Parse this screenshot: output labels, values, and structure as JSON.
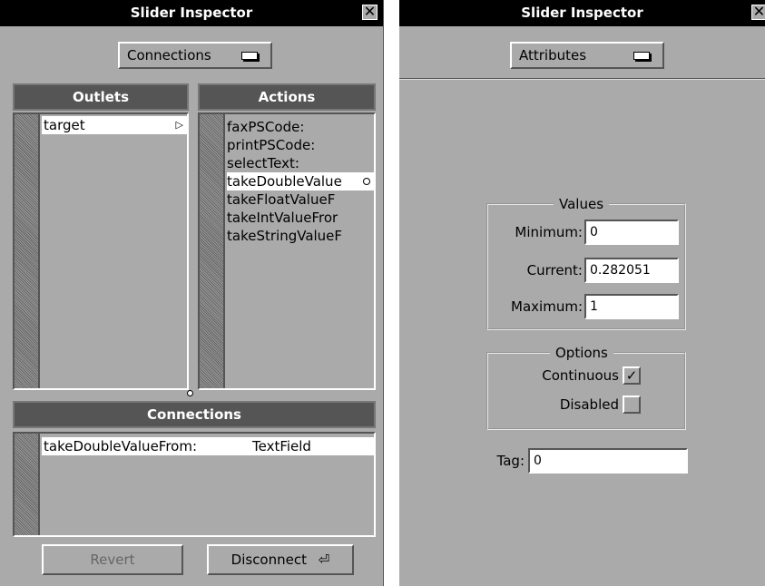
{
  "connections_inspector": {
    "title": "Slider Inspector",
    "mode_popup": "Connections",
    "outlets_header": "Outlets",
    "actions_header": "Actions",
    "outlets": [
      "target"
    ],
    "actions": [
      "faxPSCode:",
      "printPSCode:",
      "selectText:",
      "takeDoubleValue",
      "takeFloatValueF",
      "takeIntValueFror",
      "takeStringValueF"
    ],
    "selected_action": "takeDoubleValue",
    "connections_header": "Connections",
    "connections": [
      {
        "action": "takeDoubleValueFrom:",
        "target": "TextField"
      }
    ],
    "revert_label": "Revert",
    "disconnect_label": "Disconnect",
    "return_glyph": "⏎"
  },
  "attributes_inspector": {
    "title": "Slider Inspector",
    "mode_popup": "Attributes",
    "values_group": "Values",
    "minimum_label": "Minimum:",
    "minimum_value": "0",
    "current_label": "Current:",
    "current_value": "0.282051",
    "maximum_label": "Maximum:",
    "maximum_value": "1",
    "options_group": "Options",
    "continuous_label": "Continuous",
    "continuous_checked": true,
    "disabled_label": "Disabled",
    "disabled_checked": false,
    "tag_label": "Tag:",
    "tag_value": "0"
  },
  "icons": {
    "close": "close-icon",
    "popup": "popup-icon",
    "arrow": "outlet-arrow-icon"
  },
  "colors": {
    "panel_bg": "#aaaaaa",
    "titlebar_bg": "#000000",
    "header_bg": "#555555"
  }
}
